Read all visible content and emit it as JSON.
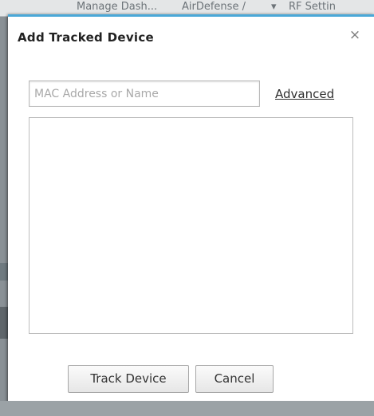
{
  "background": {
    "tabs": [
      "Manage Dash...",
      "AirDefense /",
      "RF Settin"
    ]
  },
  "dialog": {
    "title": "Add Tracked Device",
    "close_glyph": "×",
    "search": {
      "placeholder": "MAC Address or Name",
      "value": ""
    },
    "advanced_link": "Advanced",
    "results": [],
    "buttons": {
      "track_label": "Track Device",
      "cancel_label": "Cancel"
    }
  },
  "colors": {
    "accent": "#4aa8d8",
    "overlay": "#8a9196"
  },
  "icons": {
    "close": "close-icon",
    "dropdown": "chevron-down-icon"
  }
}
